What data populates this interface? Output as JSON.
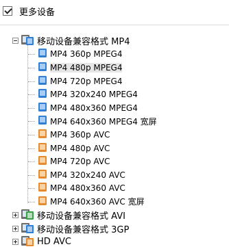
{
  "header": {
    "checked": true,
    "label": "更多设备"
  },
  "tree": {
    "groups": [
      {
        "label": "移动设备兼容格式 MP4",
        "expanded": true,
        "children": [
          {
            "label": "MP4 360p MPEG4",
            "icon": "mpeg4-blue-icon"
          },
          {
            "label": "MP4 480p MPEG4",
            "icon": "mpeg4-blue-icon",
            "selected": true
          },
          {
            "label": "MP4 720p MPEG4",
            "icon": "mpeg4-blue-icon"
          },
          {
            "label": "MP4 320x240 MPEG4",
            "icon": "mpeg4-blue-icon"
          },
          {
            "label": "MP4 480x360 MPEG4",
            "icon": "mpeg4-blue-icon"
          },
          {
            "label": "MP4 640x360 MPEG4 宽屏",
            "icon": "mpeg4-blue-icon"
          },
          {
            "label": "MP4 360p AVC",
            "icon": "avc-orange-icon"
          },
          {
            "label": "MP4 480p AVC",
            "icon": "avc-orange-icon"
          },
          {
            "label": "MP4 720p AVC",
            "icon": "avc-orange-icon"
          },
          {
            "label": "MP4 320x240 AVC",
            "icon": "avc-orange-icon"
          },
          {
            "label": "MP4 480x360 AVC",
            "icon": "avc-orange-icon"
          },
          {
            "label": "MP4 640x360 AVC 宽屏",
            "icon": "avc-orange-icon"
          }
        ]
      },
      {
        "label": "移动设备兼容格式 AVI",
        "expanded": false
      },
      {
        "label": "移动设备兼容格式 3GP",
        "expanded": false
      },
      {
        "label": "HD AVC",
        "expanded": false
      }
    ]
  },
  "colors": {
    "blue": "#2f7fd6",
    "orange": "#e8892b",
    "green": "#3aa048",
    "selected": "#e6e6e6"
  }
}
